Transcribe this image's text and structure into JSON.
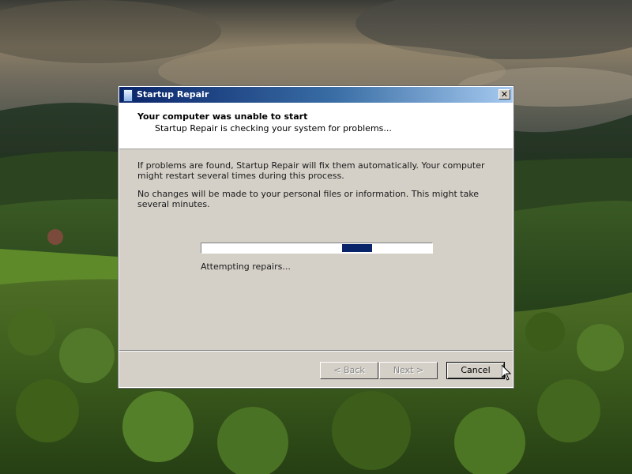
{
  "window": {
    "title": "Startup Repair",
    "close_glyph": "✕"
  },
  "header": {
    "title": "Your computer was unable to start",
    "subtitle": "Startup Repair is checking your system for problems..."
  },
  "body": {
    "paragraph1": "If problems are found, Startup Repair will fix them automatically. Your computer might restart several times during this process.",
    "paragraph2": "No changes will be made to your personal files or information. This might take several minutes."
  },
  "progress": {
    "status": "Attempting repairs...",
    "style": "marquee",
    "chunk_position_fraction": 0.63
  },
  "buttons": {
    "back": "< Back",
    "next": "Next >",
    "cancel": "Cancel"
  },
  "colors": {
    "titlebar_start": "#0a246a",
    "titlebar_end": "#a6caf0",
    "dialog_face": "#d4d0c8",
    "progress_chunk": "#0a246a"
  },
  "icons": {
    "window_icon": "startup-repair-icon",
    "close": "close-icon",
    "cursor": "mouse-pointer-icon"
  }
}
